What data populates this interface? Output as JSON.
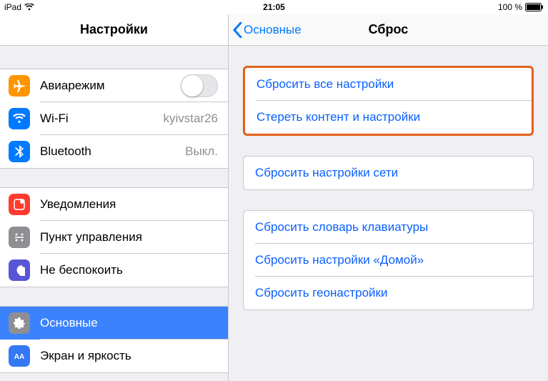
{
  "status": {
    "device": "iPad",
    "time": "21:05",
    "battery": "100 %"
  },
  "sidebar": {
    "title": "Настройки",
    "groups": [
      {
        "items": [
          {
            "label": "Авиарежим"
          },
          {
            "label": "Wi-Fi",
            "value": "kyivstar26"
          },
          {
            "label": "Bluetooth",
            "value": "Выкл."
          }
        ]
      },
      {
        "items": [
          {
            "label": "Уведомления"
          },
          {
            "label": "Пункт управления"
          },
          {
            "label": "Не беспокоить"
          }
        ]
      },
      {
        "items": [
          {
            "label": "Основные"
          },
          {
            "label": "Экран и яркость"
          }
        ]
      }
    ]
  },
  "detail": {
    "back": "Основные",
    "title": "Сброс",
    "groups": [
      {
        "highlight": true,
        "items": [
          {
            "label": "Сбросить все настройки"
          },
          {
            "label": "Стереть контент и настройки"
          }
        ]
      },
      {
        "items": [
          {
            "label": "Сбросить настройки сети"
          }
        ]
      },
      {
        "items": [
          {
            "label": "Сбросить словарь клавиатуры"
          },
          {
            "label": "Сбросить настройки «Домой»"
          },
          {
            "label": "Сбросить геонастройки"
          }
        ]
      }
    ]
  }
}
